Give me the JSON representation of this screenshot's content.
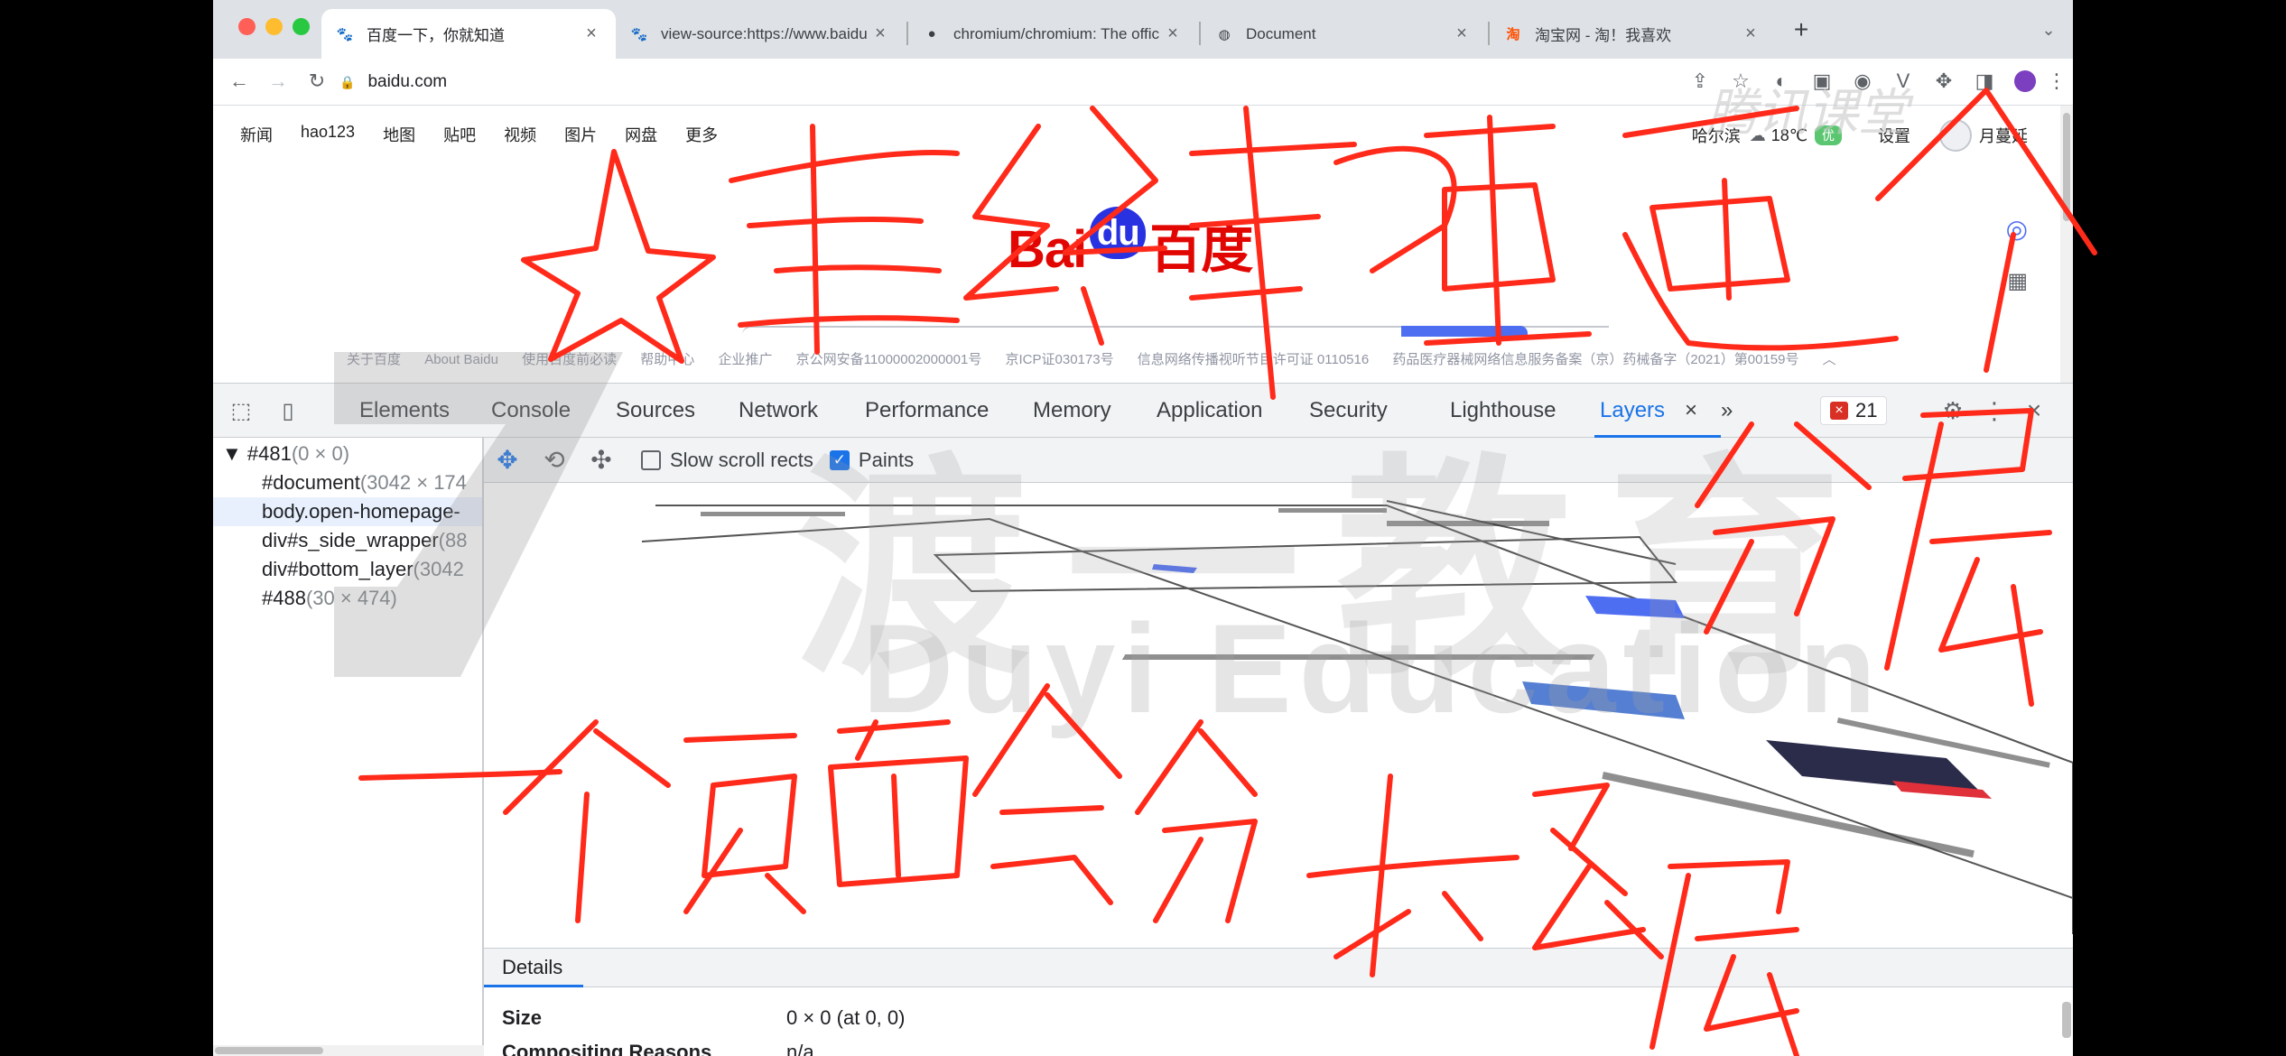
{
  "tabs": [
    {
      "title": "百度一下，你就知道",
      "active": true
    },
    {
      "title": "view-source:https://www.baidu",
      "active": false
    },
    {
      "title": "chromium/chromium: The offic",
      "active": false
    },
    {
      "title": "Document",
      "active": false
    },
    {
      "title": "淘宝网 - 淘！我喜欢",
      "active": false
    }
  ],
  "url": "baidu.com",
  "baidu": {
    "nav": [
      "新闻",
      "hao123",
      "地图",
      "贴吧",
      "视频",
      "图片",
      "网盘",
      "更多"
    ],
    "city": "哈尔滨",
    "temp": "18℃",
    "aqi": "优",
    "settings": "设置",
    "user": "月蔓延",
    "logo_left": "Bai",
    "logo_mid": "du",
    "logo_right": "百度",
    "footer": [
      "关于百度",
      "About Baidu",
      "使用百度前必读",
      "帮助中心",
      "企业推广",
      "京公网安备11000002000001号",
      "京ICP证030173号",
      "信息网络传播视听节目许可证 0110516",
      "药品医疗器械网络信息服务备案（京）药械备字（2021）第00159号"
    ]
  },
  "devtools": {
    "tabs": [
      "Elements",
      "Console",
      "Sources",
      "Network",
      "Performance",
      "Memory",
      "Application",
      "Security",
      "Lighthouse",
      "Layers"
    ],
    "more": "»",
    "error_count": "21",
    "tree": [
      {
        "name": "▼ #481",
        "size": "(0 × 0)"
      },
      {
        "name": "#document",
        "size": "(3042 × 174"
      },
      {
        "name": "body.open-homepage-",
        "size": ""
      },
      {
        "name": "div#s_side_wrapper",
        "size": "(88"
      },
      {
        "name": "div#bottom_layer",
        "size": "(3042"
      },
      {
        "name": "#488",
        "size": "(30 × 474)"
      }
    ],
    "slow_scroll": "Slow scroll rects",
    "paints": "Paints",
    "details_tab": "Details",
    "details": [
      {
        "key": "Size",
        "value": "0 × 0 (at 0, 0)"
      },
      {
        "key": "Compositing Reasons",
        "value": "n/a"
      }
    ]
  },
  "watermark": {
    "en": "Duyi Education",
    "cn": "渡一教育",
    "tencent": "腾讯课堂"
  },
  "colors": {
    "ink": "#ff2a1a",
    "accent": "#1a73e8",
    "baidu_red": "#e10602",
    "baidu_blue": "#2932e1"
  }
}
